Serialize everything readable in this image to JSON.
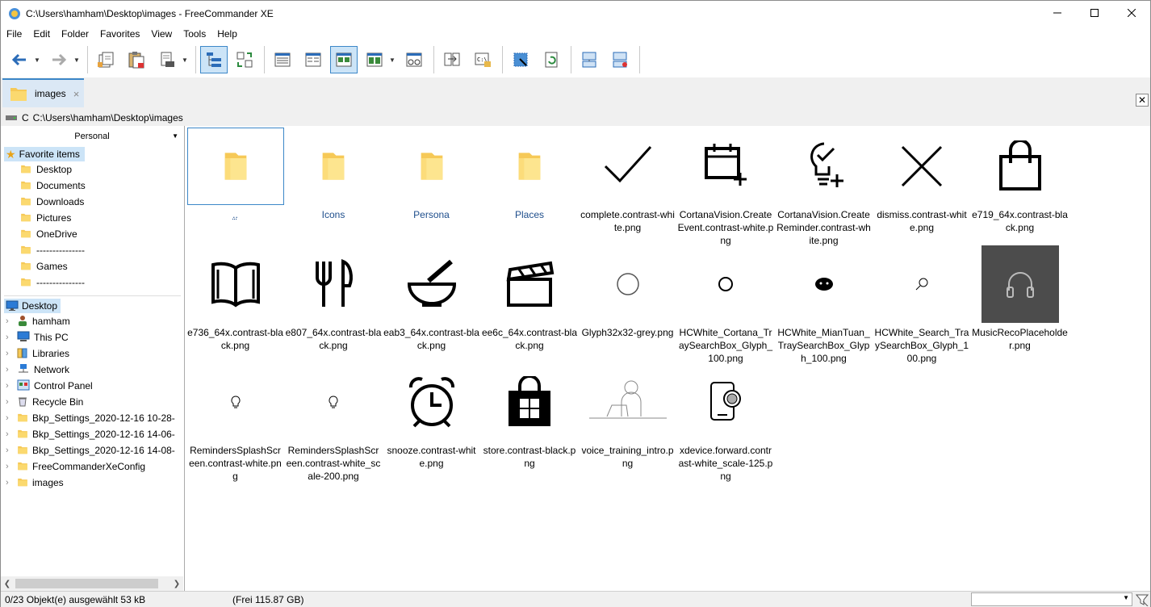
{
  "window": {
    "title": "C:\\Users\\hamham\\Desktop\\images - FreeCommander XE"
  },
  "menu": [
    "File",
    "Edit",
    "Folder",
    "Favorites",
    "View",
    "Tools",
    "Help"
  ],
  "toolbar": {
    "icons": [
      "back-arrow-icon",
      "forward-arrow-icon",
      "copy-icon",
      "paste-icon",
      "print-icon",
      "tree-view-icon",
      "sync-panels-icon",
      "details-view-icon",
      "list-view-icon",
      "thumbnail-view-icon",
      "large-thumbnail-view-icon",
      "quick-view-icon",
      "compare-icon",
      "console-icon",
      "select-icon",
      "refresh-icon",
      "drive-icon",
      "network-drive-icon"
    ]
  },
  "tab": {
    "label": "images",
    "close": "×"
  },
  "path": {
    "drive": "C",
    "path": "C:\\Users\\hamham\\Desktop\\images"
  },
  "favorites": {
    "group": "Personal",
    "header": "Favorite items",
    "items": [
      "Desktop",
      "Documents",
      "Downloads",
      "Pictures",
      "OneDrive",
      "---------------",
      "Games",
      "---------------"
    ]
  },
  "tree": {
    "root": "Desktop",
    "items": [
      "hamham",
      "This PC",
      "Libraries",
      "Network",
      "Control Panel",
      "Recycle Bin",
      "Bkp_Settings_2020-12-16 10-28-",
      "Bkp_Settings_2020-12-16 14-06-",
      "Bkp_Settings_2020-12-16 14-08-",
      "FreeCommanderXeConfig",
      "images"
    ]
  },
  "files": [
    {
      "name": "..",
      "icon": "folder-icon",
      "dir": true
    },
    {
      "name": "Icons",
      "icon": "folder-icon",
      "dir": true
    },
    {
      "name": "Persona",
      "icon": "folder-icon",
      "dir": true
    },
    {
      "name": "Places",
      "icon": "folder-icon",
      "dir": true
    },
    {
      "name": "complete.contrast-white.png",
      "icon": "checkmark-icon"
    },
    {
      "name": "CortanaVision.CreateEvent.contrast-white.png",
      "icon": "calendar-add-icon"
    },
    {
      "name": "CortanaVision.CreateReminder.contrast-white.png",
      "icon": "lightbulb-check-icon"
    },
    {
      "name": "dismiss.contrast-white.png",
      "icon": "dismiss-x-icon"
    },
    {
      "name": "e719_64x.contrast-black.png",
      "icon": "shopping-bag-icon"
    },
    {
      "name": "e736_64x.contrast-black.png",
      "icon": "book-icon"
    },
    {
      "name": "e807_64x.contrast-black.png",
      "icon": "fork-knife-icon"
    },
    {
      "name": "eab3_64x.contrast-black.png",
      "icon": "mortar-pestle-icon"
    },
    {
      "name": "ee6c_64x.contrast-black.png",
      "icon": "clapperboard-icon"
    },
    {
      "name": "Glyph32x32-grey.png",
      "icon": "circle-grey-icon"
    },
    {
      "name": "HCWhite_Cortana_TraySearchBox_Glyph_100.png",
      "icon": "cortana-ring-icon"
    },
    {
      "name": "HCWhite_MianTuan_TraySearchBox_Glyph_100.png",
      "icon": "miantuan-face-icon"
    },
    {
      "name": "HCWhite_Search_TraySearchBox_Glyph_100.png",
      "icon": "search-small-icon"
    },
    {
      "name": "MusicRecoPlaceholder.png",
      "icon": "headphones-icon"
    },
    {
      "name": "RemindersSplashScreen.contrast-white.png",
      "icon": "small-bulb-icon"
    },
    {
      "name": "RemindersSplashScreen.contrast-white_scale-200.png",
      "icon": "small-bulb-icon"
    },
    {
      "name": "snooze.contrast-white.png",
      "icon": "alarm-clock-icon"
    },
    {
      "name": "store.contrast-black.png",
      "icon": "store-bag-icon"
    },
    {
      "name": "voice_training_intro.png",
      "icon": "person-laptop-icon"
    },
    {
      "name": "xdevice.forward.contrast-white_scale-125.png",
      "icon": "phone-forward-icon"
    }
  ],
  "status": {
    "selection": "0/23 Objekt(e) ausgewählt   53 kB",
    "free": "(Frei 115.87 GB)"
  }
}
